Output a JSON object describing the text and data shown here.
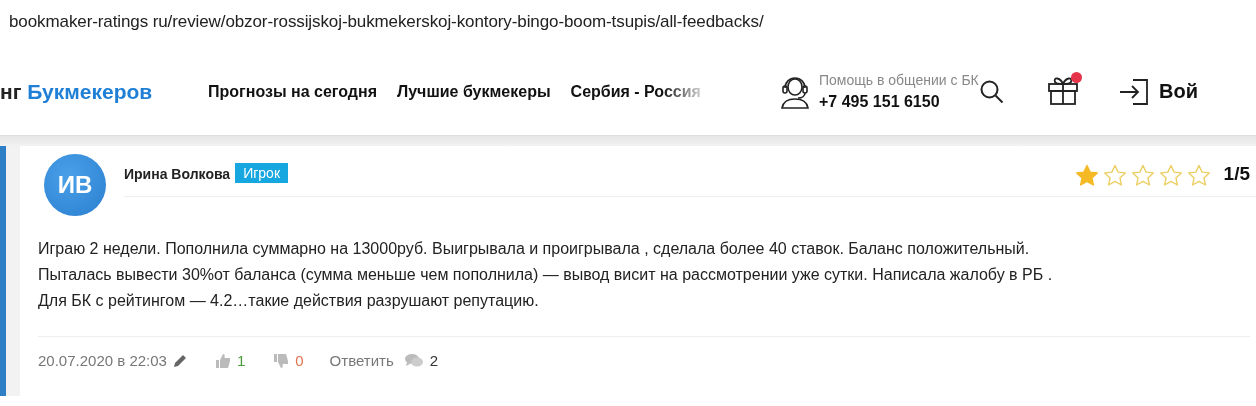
{
  "address_bar": {
    "url": "bookmaker-ratings ru/review/obzor-rossijskoj-bukmekerskoj-kontory-bingo-boom-tsupis/all-feedbacks/"
  },
  "header": {
    "logo_start": "нг",
    "logo_end": "Букмекеров",
    "nav": [
      "Прогнозы на сегодня",
      "Лучшие букмекеры",
      "Сербия - Россия"
    ],
    "support": {
      "label": "Помощь в общении с БК",
      "phone": "+7 495 151 6150"
    },
    "gift_notification": true,
    "login": "Вой"
  },
  "review": {
    "initials": "ИВ",
    "author": "Ирина Волкова",
    "badge": "Игрок",
    "stars": 1,
    "rating": "1/5",
    "text_lines": [
      "Играю 2 недели. Пополнила суммарно на 13000руб. Выигрывала и проигрывала , сделала более 40 ставок. Баланс положительный.",
      "Пыталась вывести 30%от баланса (сумма меньше чем пополнила) — вывод висит на рассмотрении уже сутки. Написала жалобу в РБ .",
      "Для БК с рейтингом — 4.2…такие действия разрушают репутацию."
    ],
    "date": "20.07.2020 в 22:03",
    "likes": "1",
    "dislikes": "0",
    "reply": "Ответить",
    "comments": "2"
  }
}
